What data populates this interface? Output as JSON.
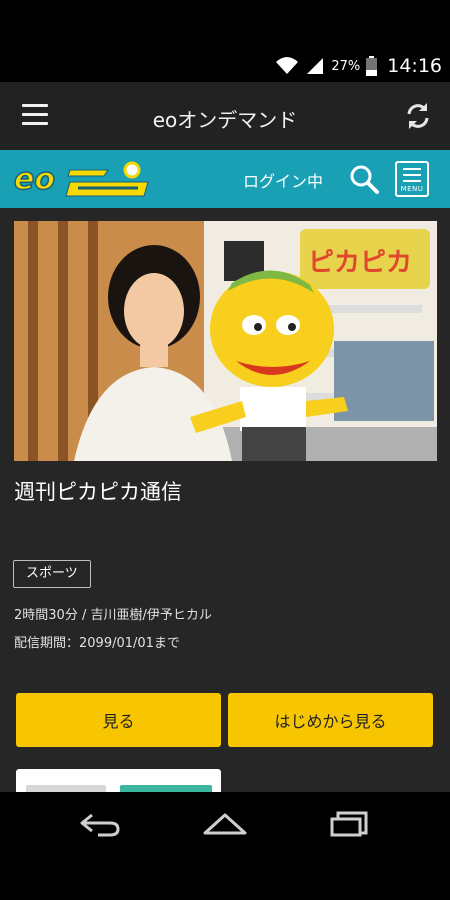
{
  "status_bar": {
    "battery": "27%",
    "time": "14:16"
  },
  "app_bar": {
    "title": "eoオンデマンド"
  },
  "brand_bar": {
    "logo_text": "eo",
    "login_status": "ログイン中",
    "menu_label": "MENU"
  },
  "program": {
    "thumbnail_overlay": "ピカピカ",
    "title": "週刊ピカピカ通信",
    "genre": "スポーツ",
    "duration_cast": "2時間30分 / 吉川亜樹/伊予ヒカル",
    "period": "配信期間：2099/01/01まで"
  },
  "actions": {
    "watch": "見る",
    "watch_from_start": "はじめから見る"
  },
  "colors": {
    "brand_teal": "#1aa0b5",
    "accent_yellow": "#f7c600",
    "app_bar": "#222222",
    "content_bg": "#262626"
  },
  "icons": [
    "wifi-icon",
    "signal-icon",
    "battery-icon",
    "hamburger-icon",
    "refresh-icon",
    "search-icon",
    "menu-icon",
    "back-icon",
    "home-icon",
    "recent-apps-icon"
  ]
}
